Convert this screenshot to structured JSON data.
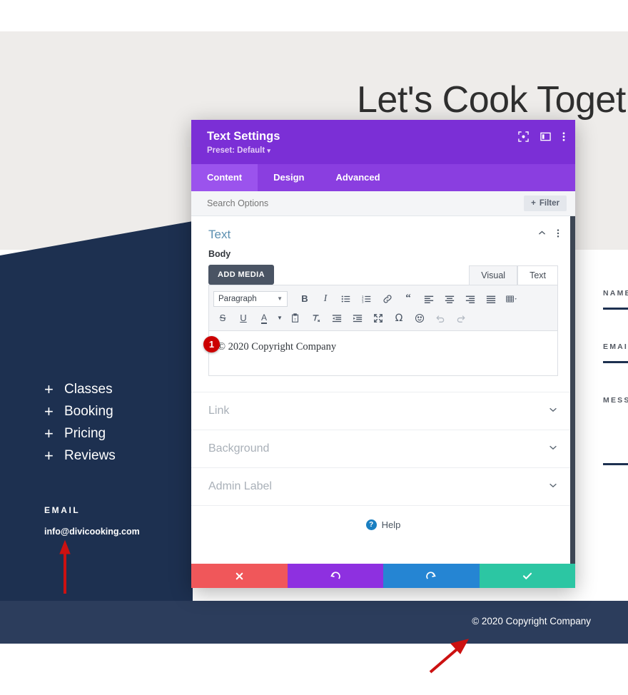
{
  "website": {
    "hero_heading": "Let's Cook Toget",
    "nav_items": [
      {
        "icon": "plus-icon",
        "label": "Classes"
      },
      {
        "icon": "plus-icon",
        "label": "Booking"
      },
      {
        "icon": "plus-icon",
        "label": "Pricing"
      },
      {
        "icon": "plus-icon",
        "label": "Reviews"
      }
    ],
    "email_heading": "EMAIL",
    "email_value": "info@divicooking.com",
    "form_labels": [
      "NAME",
      "EMAIL",
      "MESSAGE"
    ],
    "footer_text": "© 2020 Copyright Company",
    "colors": {
      "dark_panel": "#1d3050",
      "footer": "#2c3d5c",
      "top_bg": "#eeecea"
    }
  },
  "modal": {
    "title": "Text Settings",
    "preset": "Preset: Default",
    "header_icons": [
      "focus-target-icon",
      "layout-panel-icon",
      "more-vertical-icon"
    ],
    "tabs": [
      {
        "label": "Content",
        "active": true
      },
      {
        "label": "Design",
        "active": false
      },
      {
        "label": "Advanced",
        "active": false
      }
    ],
    "search": {
      "placeholder": "Search Options",
      "value": ""
    },
    "filter_button": "Filter",
    "section": {
      "title": "Text",
      "collapse_icon": "chevron-up-icon",
      "more_icon": "more-vertical-icon"
    },
    "body_field": {
      "label": "Body",
      "add_media_button": "ADD MEDIA",
      "editor_tabs": [
        {
          "label": "Visual",
          "active": false
        },
        {
          "label": "Text",
          "active": true
        }
      ],
      "format_select": "Paragraph",
      "toolbar_row1": [
        "bold-icon",
        "italic-icon",
        "bulleted-list-icon",
        "numbered-list-icon",
        "link-icon",
        "blockquote-icon",
        "align-left-icon",
        "align-center-icon",
        "align-right-icon",
        "align-justify-icon",
        "table-icon"
      ],
      "toolbar_row2": [
        "strikethrough-icon",
        "underline-icon",
        "text-color-icon",
        "paste-as-text-icon",
        "clear-formatting-icon",
        "outdent-icon",
        "indent-icon",
        "fullscreen-icon",
        "special-character-icon",
        "emoji-icon",
        "undo-icon",
        "redo-icon"
      ],
      "content": "© 2020 Copyright Company"
    },
    "accordion": [
      {
        "label": "Link",
        "icon": "chevron-down-icon"
      },
      {
        "label": "Background",
        "icon": "chevron-down-icon"
      },
      {
        "label": "Admin Label",
        "icon": "chevron-down-icon"
      }
    ],
    "help": {
      "label": "Help",
      "icon": "question-mark-icon"
    },
    "footer_buttons": [
      {
        "name": "cancel",
        "icon": "close-x-icon",
        "color": "#f0575a"
      },
      {
        "name": "undo",
        "icon": "undo-arrow-icon",
        "color": "#8e30e0"
      },
      {
        "name": "redo",
        "icon": "redo-arrow-icon",
        "color": "#2585d3"
      },
      {
        "name": "save",
        "icon": "checkmark-icon",
        "color": "#2cc6a3"
      }
    ],
    "colors": {
      "header": "#7b2fd6",
      "tabbar": "#8a3ee0",
      "tab_active": "#9b53ed"
    }
  },
  "annotations": {
    "badge_number": "1",
    "arrow_color": "#cc1111",
    "arrows": [
      "arrow-up-to-email",
      "arrow-up-right-to-footer"
    ]
  }
}
